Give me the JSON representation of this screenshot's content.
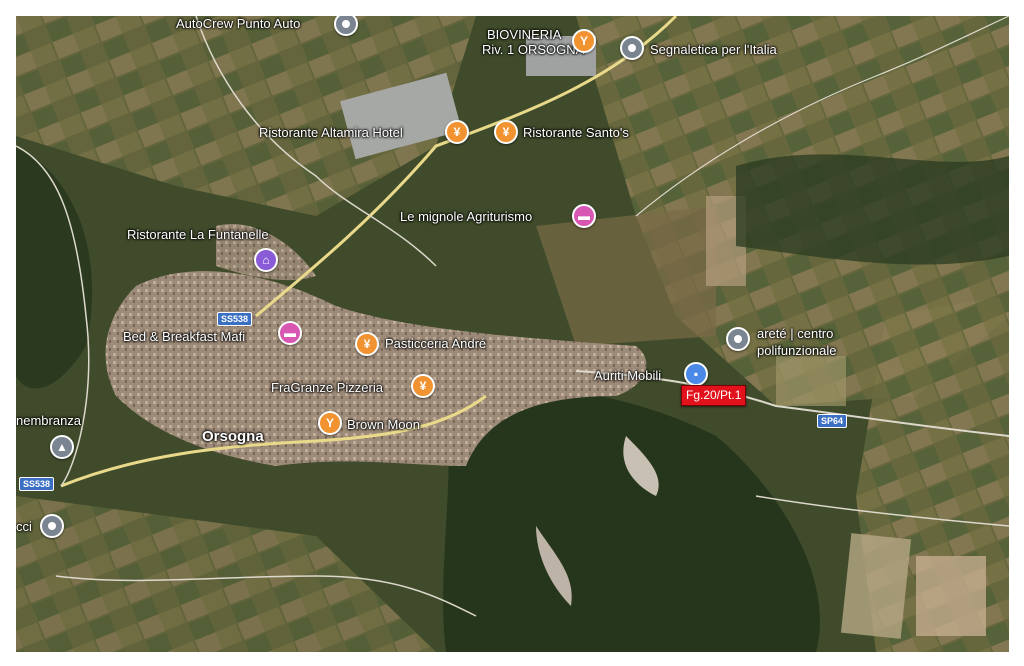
{
  "map": {
    "places": [
      {
        "id": "autocrew",
        "label": "AutoCrew Punto Auto",
        "category": "generic",
        "icon": "generic-pin-icon"
      },
      {
        "id": "biovineria",
        "label": "BIOVINERIA",
        "label2": "Riv. 1 ORSOGNA",
        "category": "food",
        "icon": "cocktail-icon"
      },
      {
        "id": "segnaletica",
        "label": "Segnaletica per l'Italia",
        "category": "generic",
        "icon": "generic-pin-icon"
      },
      {
        "id": "altamira",
        "label": "Ristorante Altamira Hotel",
        "category": "food",
        "icon": "fork-knife-icon"
      },
      {
        "id": "santos",
        "label": "Ristorante Santo's",
        "category": "food",
        "icon": "fork-knife-icon"
      },
      {
        "id": "mignole",
        "label": "Le mignole Agriturismo",
        "category": "hotel",
        "icon": "bed-icon"
      },
      {
        "id": "funtanelle",
        "label": "Ristorante La Funtanelle",
        "category": "museum",
        "icon": "building-icon"
      },
      {
        "id": "bedbreakfast",
        "label": "Bed & Breakfast Mafi",
        "category": "hotel",
        "icon": "bed-icon"
      },
      {
        "id": "pasticceria",
        "label": "Pasticceria André",
        "category": "food",
        "icon": "fork-knife-icon"
      },
      {
        "id": "fragranze",
        "label": "FraGranze Pizzeria",
        "category": "food",
        "icon": "fork-knife-icon"
      },
      {
        "id": "brownmoon",
        "label": "Brown Moon",
        "category": "food",
        "icon": "cocktail-icon"
      },
      {
        "id": "arete",
        "label": "areté | centro",
        "label2": "polifunzionale",
        "category": "generic",
        "icon": "generic-pin-icon"
      },
      {
        "id": "auriti",
        "label": "Auriti Mobili",
        "category": "shop",
        "icon": "shopping-bag-icon"
      },
      {
        "id": "rimembranza",
        "label": "nembranza",
        "category": "generic",
        "icon": "monument-icon"
      },
      {
        "id": "cci",
        "label": "cci",
        "category": "generic",
        "icon": "generic-pin-icon"
      }
    ],
    "town": "Orsogna",
    "roads": [
      "SS538",
      "SS538",
      "SP64"
    ],
    "marker_label": "Fg.20/Pt.1",
    "colors": {
      "food": "#f19331",
      "hotel": "#d857b2",
      "generic": "#7a8591",
      "shop": "#4a89e7",
      "marker": "#e1121b",
      "road": "#e9d98a"
    }
  }
}
